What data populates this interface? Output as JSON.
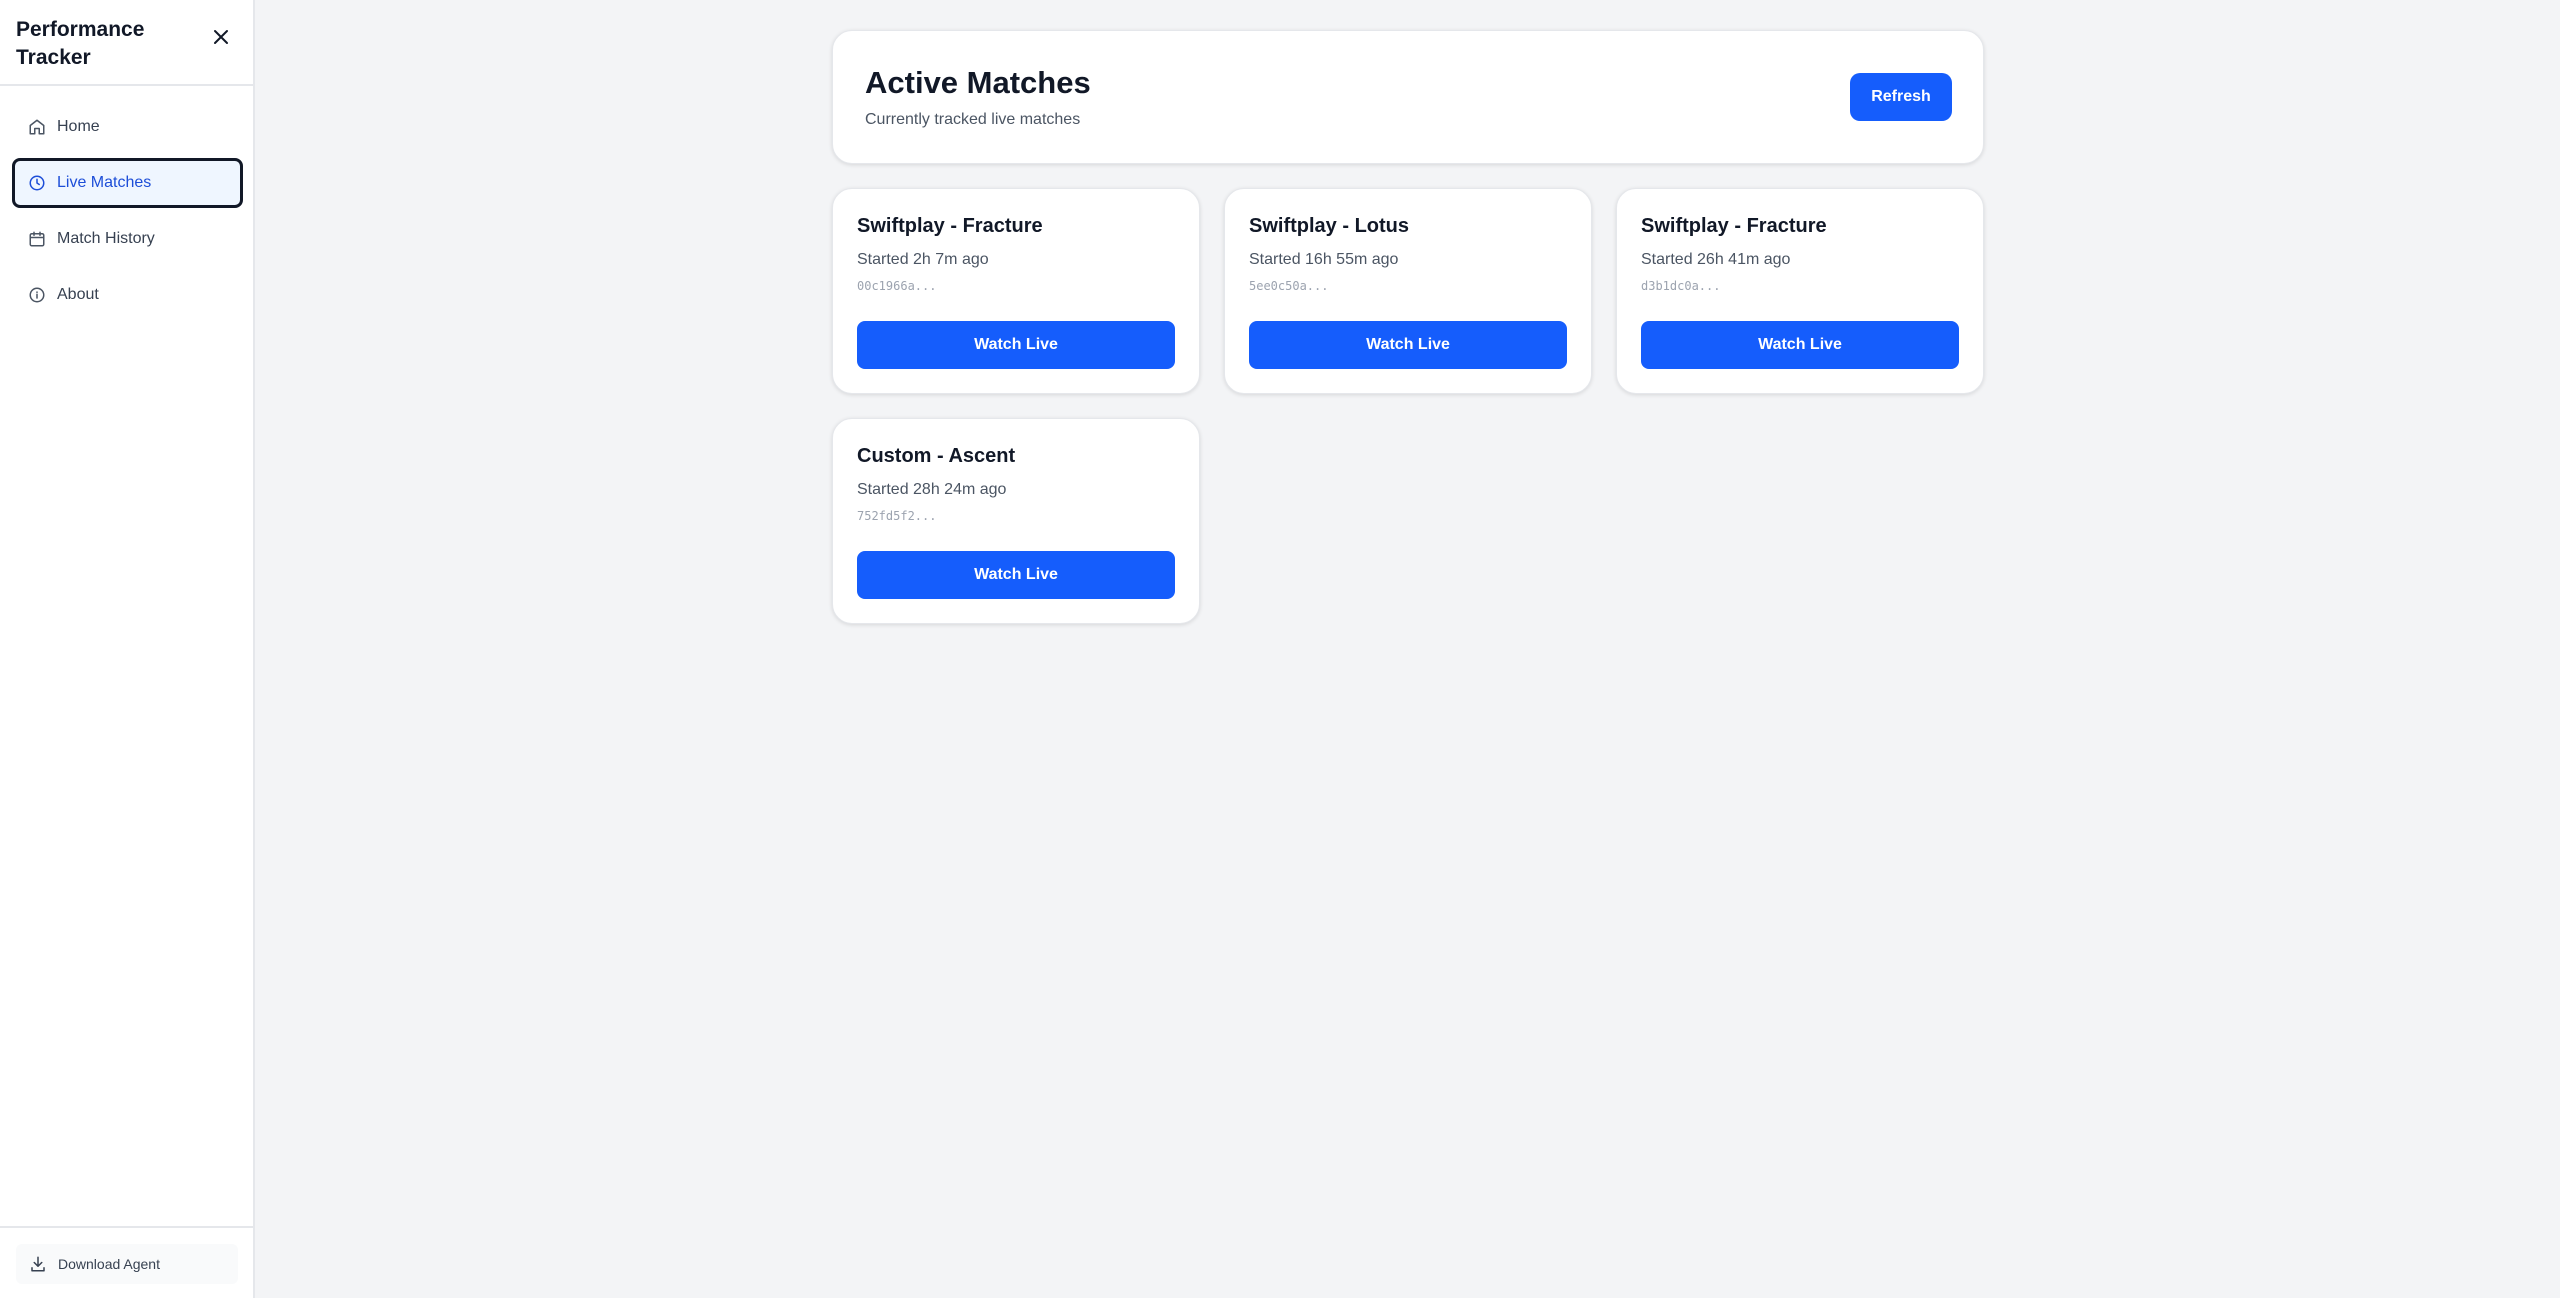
{
  "sidebar": {
    "app_title": "Performance Tracker",
    "close_icon": "close-icon",
    "items": [
      {
        "label": "Home",
        "icon": "home-icon",
        "active": false
      },
      {
        "label": "Live Matches",
        "icon": "clock-icon",
        "active": true
      },
      {
        "label": "Match History",
        "icon": "calendar-icon",
        "active": false
      },
      {
        "label": "About",
        "icon": "info-icon",
        "active": false
      }
    ],
    "download_label": "Download Agent",
    "download_icon": "download-icon"
  },
  "header": {
    "title": "Active Matches",
    "subtitle": "Currently tracked live matches",
    "refresh_label": "Refresh"
  },
  "matches": [
    {
      "title": "Swiftplay - Fracture",
      "started": "Started 2h 7m ago",
      "id": "00c1966a...",
      "button": "Watch Live"
    },
    {
      "title": "Swiftplay - Lotus",
      "started": "Started 16h 55m ago",
      "id": "5ee0c50a...",
      "button": "Watch Live"
    },
    {
      "title": "Swiftplay - Fracture",
      "started": "Started 26h 41m ago",
      "id": "d3b1dc0a...",
      "button": "Watch Live"
    },
    {
      "title": "Custom - Ascent",
      "started": "Started 28h 24m ago",
      "id": "752fd5f2...",
      "button": "Watch Live"
    }
  ],
  "colors": {
    "accent": "#155dfc",
    "active_nav_bg": "#eff6ff",
    "active_nav_text": "#1d4ed8",
    "background": "#f3f4f6"
  }
}
